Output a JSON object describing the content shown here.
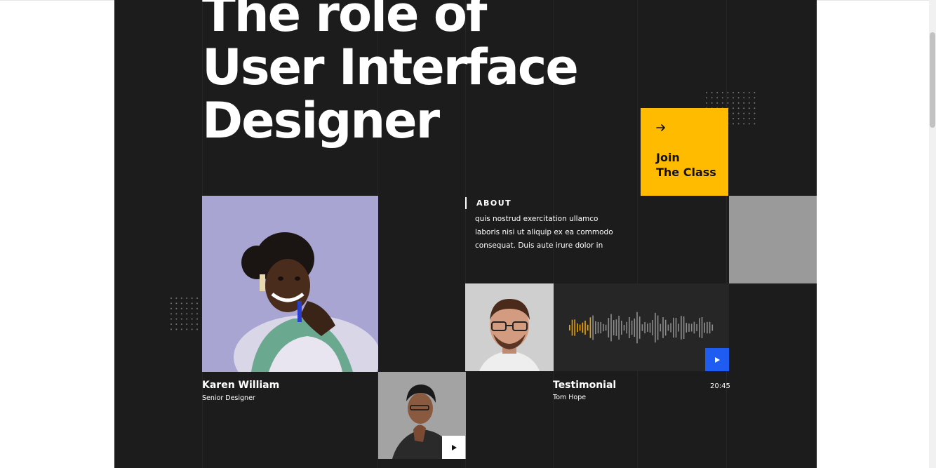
{
  "hero": {
    "title_lines": [
      "The role of",
      "User Interface",
      "Designer"
    ]
  },
  "cta": {
    "icon": "arrow-right-icon",
    "label_line1": "Join",
    "label_line2": "The Class",
    "color": "#ffbb00"
  },
  "about": {
    "label": "ABOUT",
    "text_lines": [
      "quis nostrud exercitation ullamco",
      "laboris nisi ut aliquip ex ea commodo",
      "consequat. Duis aute irure dolor in"
    ]
  },
  "profile": {
    "name": "Karen William",
    "role": "Senior Designer"
  },
  "testimonial": {
    "title": "Testimonial",
    "author": "Tom Hope",
    "duration": "20:45",
    "play_icon": "play-icon",
    "accent": "#1e5cf2"
  },
  "video": {
    "play_icon": "play-icon"
  },
  "colors": {
    "background": "#1c1c1c",
    "wave_active": "#f0a500",
    "wave_idle": "#8c8c8c"
  }
}
